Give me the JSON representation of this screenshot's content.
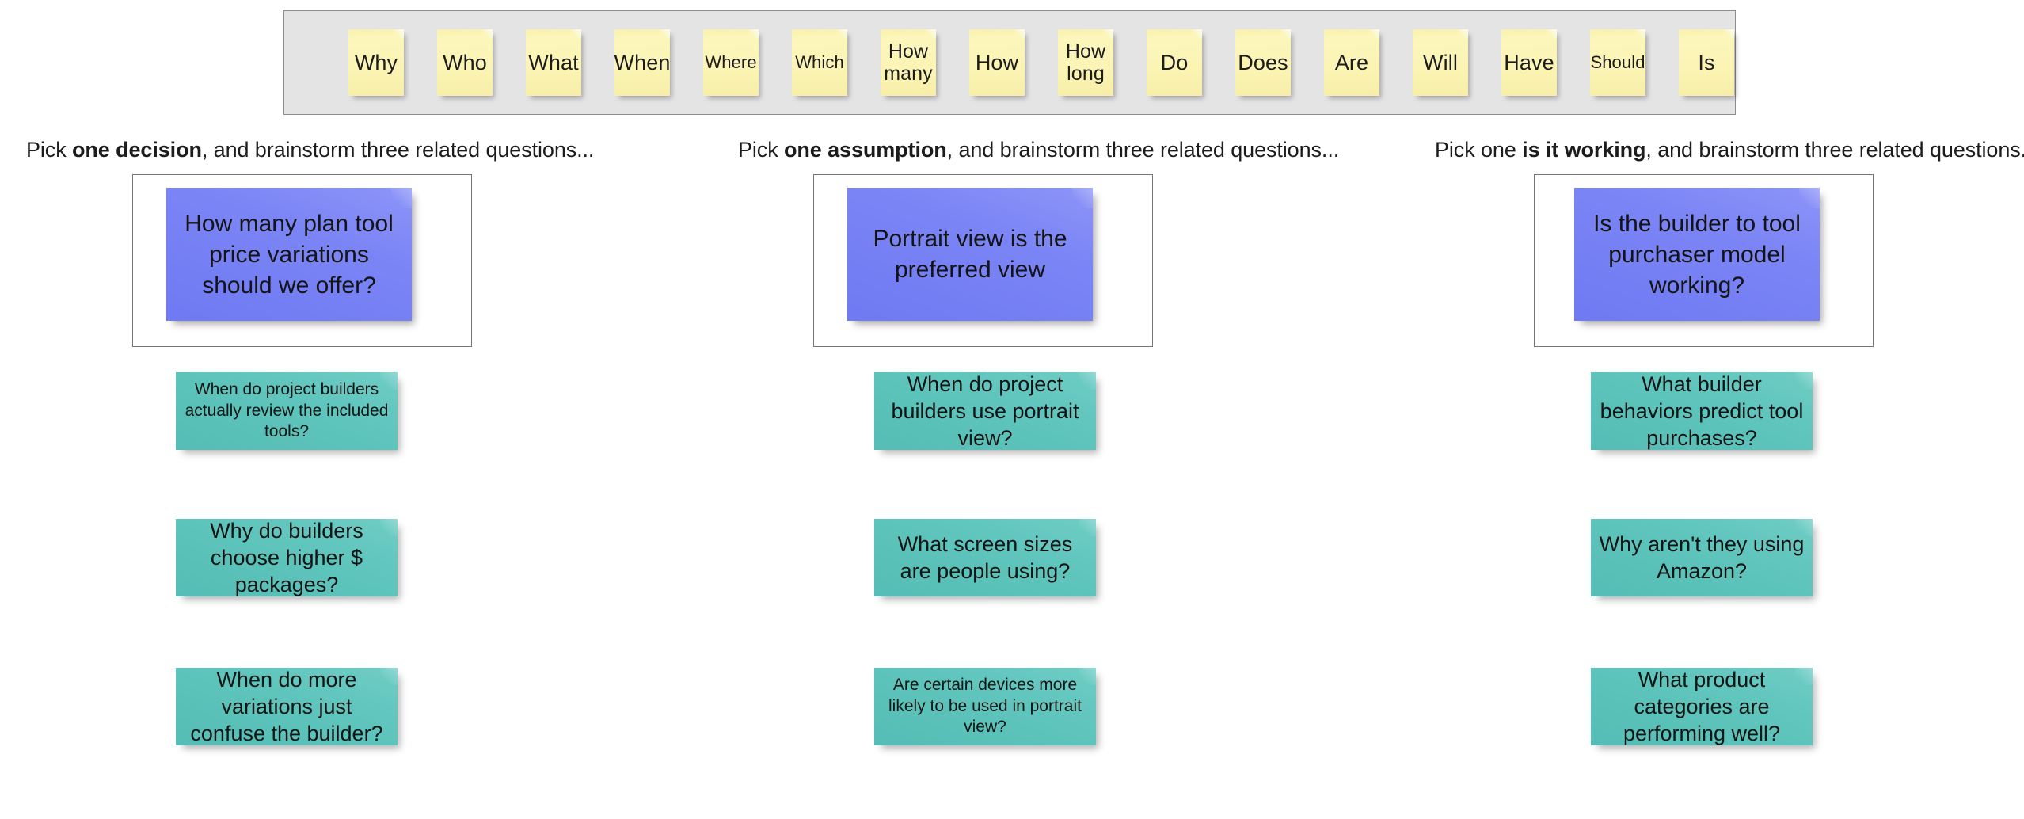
{
  "colors": {
    "panel_background": "#e4e4e4",
    "panel_border": "#8d8d8d",
    "question_word_note": "#fbf4b4",
    "focus_note": "#7b85f5",
    "question_note": "#5fc5bd",
    "box_border": "#767676",
    "canvas_background": "#ffffff",
    "text": "#1a1a1a"
  },
  "question_words": {
    "items": [
      {
        "label": "Why",
        "size": "normal"
      },
      {
        "label": "Who",
        "size": "normal"
      },
      {
        "label": "What",
        "size": "normal"
      },
      {
        "label": "When",
        "size": "normal"
      },
      {
        "label": "Where",
        "size": "small"
      },
      {
        "label": "Which",
        "size": "small"
      },
      {
        "label": "How many",
        "size": "two-line"
      },
      {
        "label": "How",
        "size": "normal"
      },
      {
        "label": "How long",
        "size": "two-line"
      },
      {
        "label": "Do",
        "size": "normal"
      },
      {
        "label": "Does",
        "size": "normal"
      },
      {
        "label": "Are",
        "size": "normal"
      },
      {
        "label": "Will",
        "size": "normal"
      },
      {
        "label": "Have",
        "size": "normal"
      },
      {
        "label": "Should",
        "size": "small"
      },
      {
        "label": "Is",
        "size": "normal"
      }
    ]
  },
  "columns": [
    {
      "prompt_prefix": "Pick ",
      "prompt_bold": "one decision",
      "prompt_suffix": ", and brainstorm three related questions...",
      "focus_note": "How many plan tool price variations should we offer?",
      "questions": [
        {
          "text": "When do project builders actually review the included tools?",
          "size": "small"
        },
        {
          "text": "Why do builders choose higher $ packages?",
          "size": "large"
        },
        {
          "text": "When do more variations just confuse the builder?",
          "size": "large"
        }
      ]
    },
    {
      "prompt_prefix": "Pick ",
      "prompt_bold": "one assumption",
      "prompt_suffix": ", and brainstorm three related questions...",
      "focus_note": "Portrait view is the preferred view",
      "questions": [
        {
          "text": "When do project builders use portrait view?",
          "size": "large"
        },
        {
          "text": "What screen sizes are people using?",
          "size": "large"
        },
        {
          "text": "Are certain devices more likely to be used in portrait view?",
          "size": "small"
        }
      ]
    },
    {
      "prompt_prefix": "Pick one ",
      "prompt_bold": "is it working",
      "prompt_suffix": ", and brainstorm three related questions...",
      "focus_note": "Is the builder to tool purchaser model working?",
      "questions": [
        {
          "text": "What builder behaviors predict tool purchases?",
          "size": "large"
        },
        {
          "text": "Why aren't they using Amazon?",
          "size": "large"
        },
        {
          "text": "What product categories are performing well?",
          "size": "large"
        }
      ]
    }
  ]
}
